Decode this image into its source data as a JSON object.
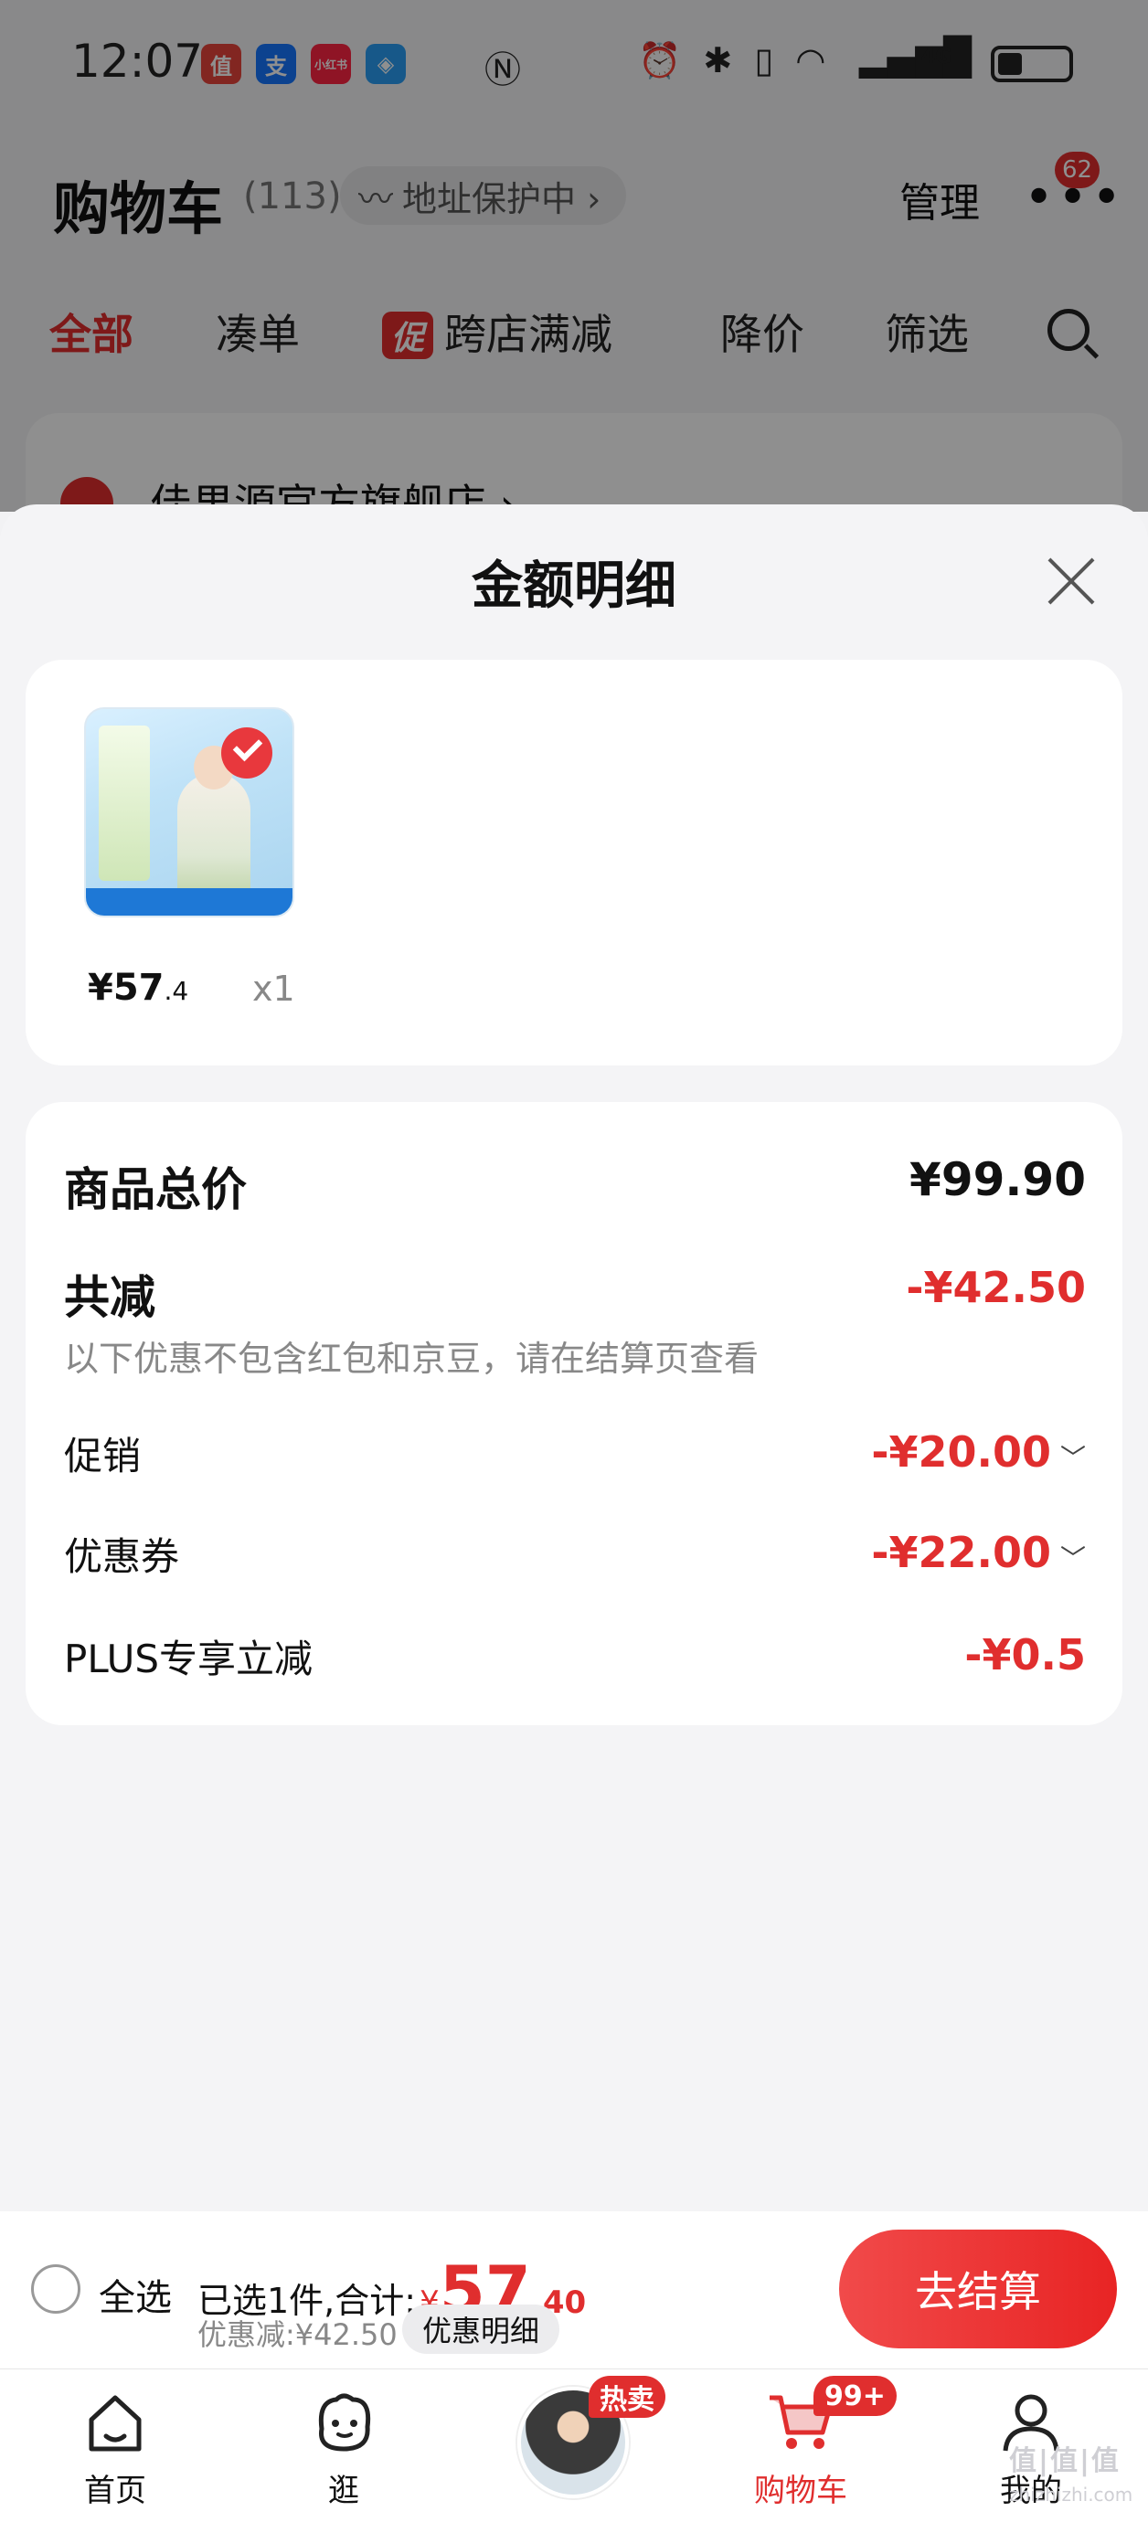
{
  "status_bar": {
    "time": "12:07",
    "apps": [
      {
        "label": "值",
        "color": "#e8453c"
      },
      {
        "label": "支",
        "color": "#1677ff"
      },
      {
        "label": "小红书",
        "color": "#ff2442"
      },
      {
        "label": "◈",
        "color": "#2a9df4"
      }
    ],
    "network": "4G"
  },
  "cart": {
    "title": "购物车",
    "count": "(113)",
    "address": "地址保护中 ›",
    "manage": "管理",
    "more_badge": "62"
  },
  "tabs": [
    {
      "label": "全部",
      "active": true
    },
    {
      "label": "凑单"
    },
    {
      "label": "跨店满减",
      "tag": "促"
    },
    {
      "label": "降价"
    },
    {
      "label": "筛选"
    }
  ],
  "store": {
    "name": "佳果源官方旗舰店 ›"
  },
  "sheet": {
    "title": "金额明细",
    "product": {
      "price_int": "¥57",
      "price_dec": ".4",
      "qty": "x1"
    },
    "total": {
      "label": "商品总价",
      "value": "¥99.90"
    },
    "reduction": {
      "label": "共减",
      "value": "-¥42.50",
      "note": "以下优惠不包含红包和京豆，请在结算页查看"
    },
    "items": [
      {
        "label": "促销",
        "value": "-¥20.00",
        "chevron": "﹀"
      },
      {
        "label": "优惠券",
        "value": "-¥22.00",
        "chevron": "﹀"
      },
      {
        "label": "PLUS专享立减",
        "value": "-¥0.5"
      }
    ]
  },
  "checkout": {
    "select_all": "全选",
    "selected_text": "已选1件,合计:",
    "currency": "¥",
    "total_int": "57",
    "total_dec": ".40",
    "discount": "优惠减:¥42.50",
    "detail_button": "优惠明细",
    "submit": "去结算"
  },
  "nav": {
    "items": [
      {
        "label": "首页"
      },
      {
        "label": "逛"
      },
      {
        "label": "",
        "badge": "热卖"
      },
      {
        "label": "购物车",
        "badge": "99+",
        "active": true
      },
      {
        "label": "我的"
      }
    ]
  },
  "watermark": {
    "text": "值|值|值",
    "sub": "zhizhizhi.com"
  },
  "colors": {
    "accent": "#e02e2e",
    "sheet_bg": "#f4f4f6"
  }
}
